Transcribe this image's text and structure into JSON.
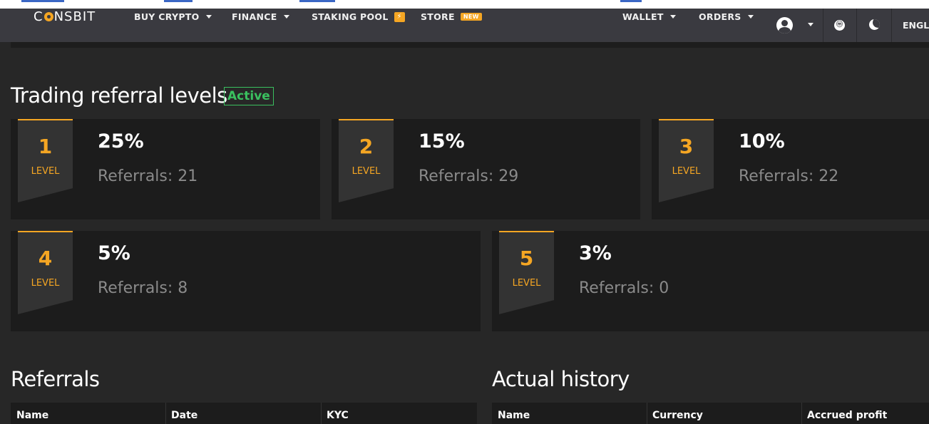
{
  "brand": {
    "logo_text_pre": "C",
    "logo_text_post": "NSBIT"
  },
  "nav": {
    "buy_crypto": "BUY CRYPTO",
    "finance": "FINANCE",
    "staking_pool": "STAKING POOL",
    "store": "STORE",
    "store_badge": "NEW",
    "wallet": "WALLET",
    "orders": "ORDERS",
    "language": "ENGLI"
  },
  "levels_section": {
    "title": "Trading referral levels",
    "status": "Active",
    "level_word": "LEVEL",
    "levels": [
      {
        "number": "1",
        "percent": "25%",
        "referrals": "Referrals: 21"
      },
      {
        "number": "2",
        "percent": "15%",
        "referrals": "Referrals: 29"
      },
      {
        "number": "3",
        "percent": "10%",
        "referrals": "Referrals: 22"
      },
      {
        "number": "4",
        "percent": "5%",
        "referrals": "Referrals: 8"
      },
      {
        "number": "5",
        "percent": "3%",
        "referrals": "Referrals: 0"
      }
    ]
  },
  "referrals_table": {
    "title": "Referrals",
    "columns": [
      "Name",
      "Date",
      "KYC"
    ]
  },
  "history_table": {
    "title": "Actual history",
    "columns": [
      "Name",
      "Currency",
      "Accrued profit"
    ]
  },
  "colors": {
    "accent": "#f5a623",
    "active": "#3ac05f",
    "navbar": "#3a3a40",
    "card": "#1c1c1c",
    "background": "#272727"
  }
}
